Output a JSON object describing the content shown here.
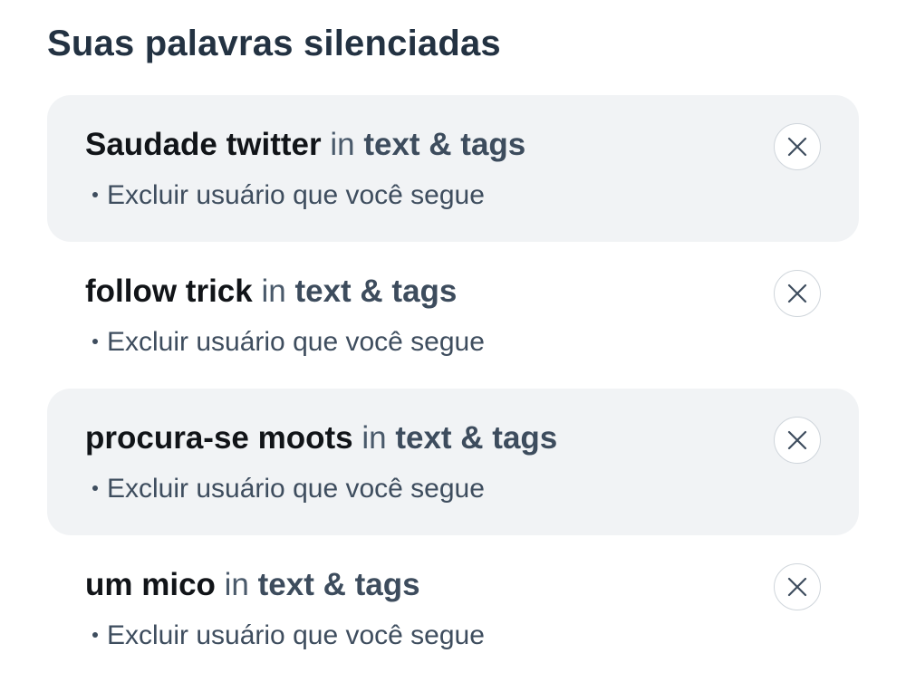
{
  "page": {
    "title": "Suas palavras silenciadas"
  },
  "muted_words": [
    {
      "word": "Saudade twitter",
      "connector": "in",
      "scope": "text & tags",
      "option": "Excluir usuário que você segue",
      "shaded": true
    },
    {
      "word": "follow trick",
      "connector": "in",
      "scope": "text & tags",
      "option": "Excluir usuário que você segue",
      "shaded": false
    },
    {
      "word": "procura-se moots",
      "connector": "in",
      "scope": "text & tags",
      "option": "Excluir usuário que você segue",
      "shaded": true
    },
    {
      "word": "um mico",
      "connector": "in",
      "scope": "text & tags",
      "option": "Excluir usuário que você segue",
      "shaded": false
    }
  ],
  "icons": {
    "remove": "close-icon"
  },
  "colors": {
    "title": "#233242",
    "shaded_row": "#f1f3f5",
    "word": "#111418",
    "secondary": "#3e4d5e"
  }
}
